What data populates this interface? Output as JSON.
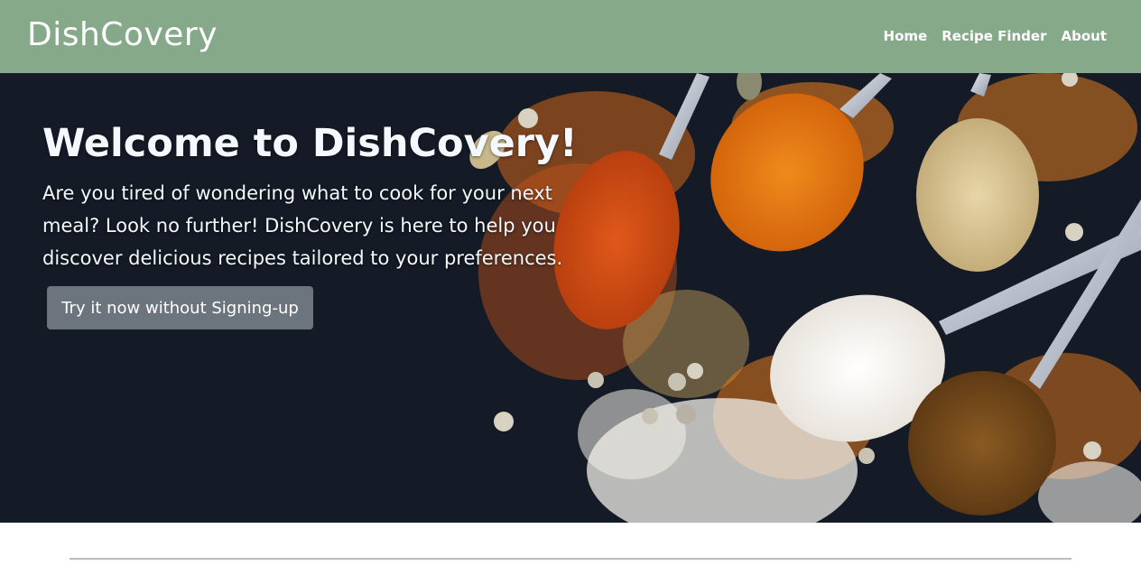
{
  "navbar": {
    "brand": "DishCovery",
    "links": [
      "Home",
      "Recipe Finder",
      "About"
    ]
  },
  "hero": {
    "title": "Welcome to DishCovery!",
    "text": "Are you tired of wondering what to cook for your next meal? Look no further! DishCovery is here to help you discover delicious recipes tailored to your preferences.",
    "button_label": "Try it now without Signing-up"
  },
  "colors": {
    "navbar": "#86a98a",
    "hero_background": "#141b26",
    "button": "#6c757d"
  }
}
